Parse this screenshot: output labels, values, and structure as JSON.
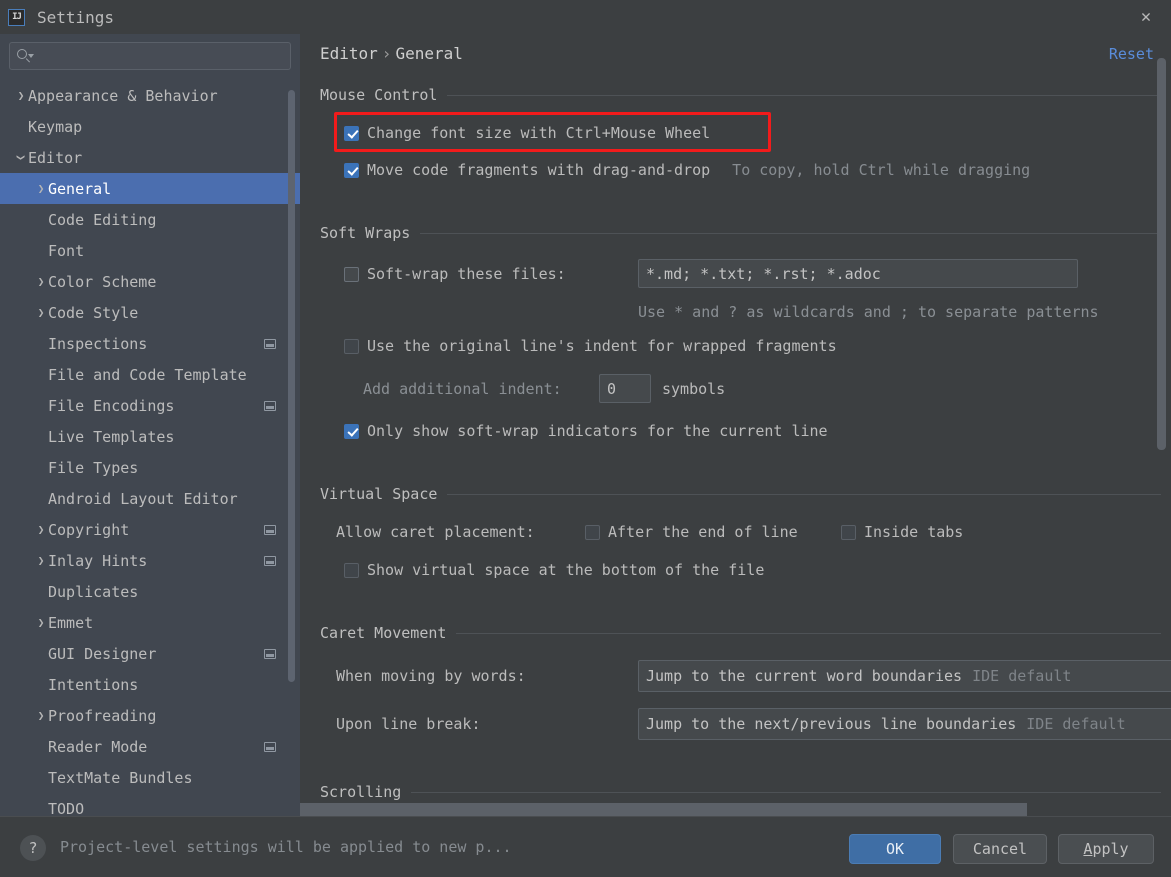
{
  "window": {
    "title": "Settings",
    "logo_text": "IJ",
    "close_label": "✕"
  },
  "search": {
    "placeholder": "",
    "value": "",
    "icon": "search-icon"
  },
  "sidebar": {
    "items": [
      {
        "label": "Appearance & Behavior",
        "level": 0,
        "arrow": "right",
        "badge": false,
        "selected": false
      },
      {
        "label": "Keymap",
        "level": 0,
        "arrow": "none",
        "badge": false,
        "selected": false
      },
      {
        "label": "Editor",
        "level": 0,
        "arrow": "down",
        "badge": false,
        "selected": false
      },
      {
        "label": "General",
        "level": 1,
        "arrow": "right",
        "badge": false,
        "selected": true
      },
      {
        "label": "Code Editing",
        "level": 1,
        "arrow": "none",
        "badge": false,
        "selected": false
      },
      {
        "label": "Font",
        "level": 1,
        "arrow": "none",
        "badge": false,
        "selected": false
      },
      {
        "label": "Color Scheme",
        "level": 1,
        "arrow": "right",
        "badge": false,
        "selected": false
      },
      {
        "label": "Code Style",
        "level": 1,
        "arrow": "right",
        "badge": false,
        "selected": false
      },
      {
        "label": "Inspections",
        "level": 1,
        "arrow": "none",
        "badge": true,
        "selected": false
      },
      {
        "label": "File and Code Template",
        "level": 1,
        "arrow": "none",
        "badge": false,
        "selected": false
      },
      {
        "label": "File Encodings",
        "level": 1,
        "arrow": "none",
        "badge": true,
        "selected": false
      },
      {
        "label": "Live Templates",
        "level": 1,
        "arrow": "none",
        "badge": false,
        "selected": false
      },
      {
        "label": "File Types",
        "level": 1,
        "arrow": "none",
        "badge": false,
        "selected": false
      },
      {
        "label": "Android Layout Editor",
        "level": 1,
        "arrow": "none",
        "badge": false,
        "selected": false
      },
      {
        "label": "Copyright",
        "level": 1,
        "arrow": "right",
        "badge": true,
        "selected": false
      },
      {
        "label": "Inlay Hints",
        "level": 1,
        "arrow": "right",
        "badge": true,
        "selected": false
      },
      {
        "label": "Duplicates",
        "level": 1,
        "arrow": "none",
        "badge": false,
        "selected": false
      },
      {
        "label": "Emmet",
        "level": 1,
        "arrow": "right",
        "badge": false,
        "selected": false
      },
      {
        "label": "GUI Designer",
        "level": 1,
        "arrow": "none",
        "badge": true,
        "selected": false
      },
      {
        "label": "Intentions",
        "level": 1,
        "arrow": "none",
        "badge": false,
        "selected": false
      },
      {
        "label": "Proofreading",
        "level": 1,
        "arrow": "right",
        "badge": false,
        "selected": false
      },
      {
        "label": "Reader Mode",
        "level": 1,
        "arrow": "none",
        "badge": true,
        "selected": false
      },
      {
        "label": "TextMate Bundles",
        "level": 1,
        "arrow": "none",
        "badge": false,
        "selected": false
      },
      {
        "label": "TODO",
        "level": 1,
        "arrow": "none",
        "badge": false,
        "selected": false
      }
    ]
  },
  "content": {
    "breadcrumb": {
      "parent": "Editor",
      "separator": "›",
      "current": "General"
    },
    "reset_label": "Reset",
    "sections": {
      "mouse_control": {
        "title": "Mouse Control",
        "change_font_size": {
          "label": "Change font size with Ctrl+Mouse Wheel",
          "checked": true
        },
        "move_code_fragments": {
          "label": "Move code fragments with drag-and-drop",
          "checked": true
        },
        "move_code_hint": "To copy, hold Ctrl while dragging"
      },
      "soft_wraps": {
        "title": "Soft Wraps",
        "soft_wrap_files": {
          "label": "Soft-wrap these files:",
          "checked": false
        },
        "soft_wrap_value": "*.md; *.txt; *.rst; *.adoc",
        "wildcard_hint": "Use * and ? as wildcards and ; to separate patterns",
        "original_indent": {
          "label": "Use the original line's indent for wrapped fragments",
          "checked": false
        },
        "add_indent_label": "Add additional indent:",
        "add_indent_value": "0",
        "add_indent_suffix": "symbols",
        "only_show_indicators": {
          "label": "Only show soft-wrap indicators for the current line",
          "checked": true
        }
      },
      "virtual_space": {
        "title": "Virtual Space",
        "allow_caret_label": "Allow caret placement:",
        "after_end_of_line": {
          "label": "After the end of line",
          "checked": false
        },
        "inside_tabs": {
          "label": "Inside tabs",
          "checked": false
        },
        "show_virtual_space": {
          "label": "Show virtual space at the bottom of the file",
          "checked": false
        }
      },
      "caret_movement": {
        "title": "Caret Movement",
        "moving_by_words_label": "When moving by words:",
        "moving_by_words_value": "Jump to the current word boundaries",
        "moving_by_words_suffix": "IDE default",
        "line_break_label": "Upon line break:",
        "line_break_value": "Jump to the next/previous line boundaries",
        "line_break_suffix": "IDE default"
      },
      "scrolling": {
        "title": "Scrolling"
      }
    }
  },
  "footer": {
    "help_glyph": "?",
    "status": "Project-level settings will be applied to new p...",
    "ok_label": "OK",
    "cancel_label": "Cancel",
    "apply_mnemonic": "A",
    "apply_rest": "pply"
  },
  "colors": {
    "accent_blue": "#4b6eaf",
    "link_blue": "#5a8ddb",
    "highlight_red": "#f21b1b",
    "sidebar_bg": "#414750",
    "content_bg": "#3c3f41"
  }
}
